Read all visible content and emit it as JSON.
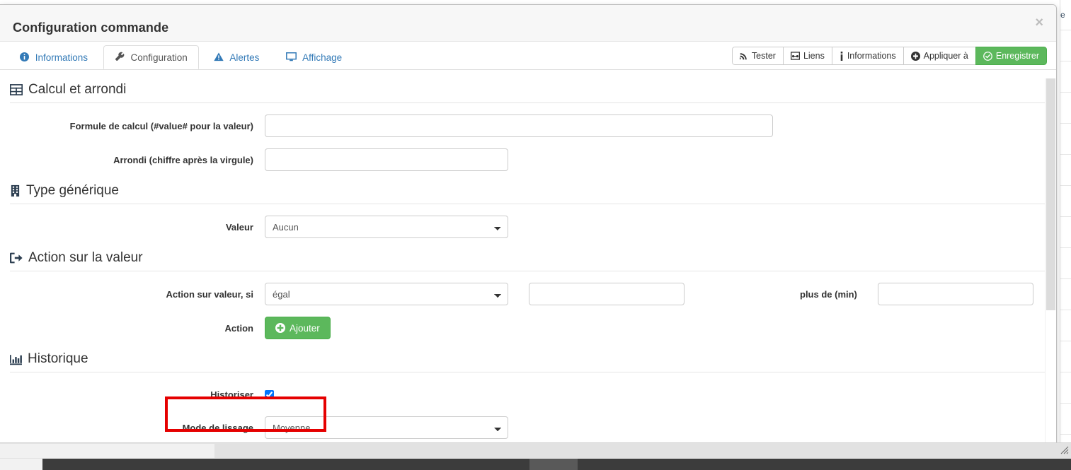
{
  "window": {
    "title": "Configuration commande",
    "close_label": "×"
  },
  "tabs": [
    {
      "label": "Informations",
      "icon": "info-circle-icon",
      "active": false
    },
    {
      "label": "Configuration",
      "icon": "wrench-icon",
      "active": true
    },
    {
      "label": "Alertes",
      "icon": "warning-triangle-icon",
      "active": false
    },
    {
      "label": "Affichage",
      "icon": "monitor-icon",
      "active": false
    }
  ],
  "toolbar": {
    "tester_label": "Tester",
    "liens_label": "Liens",
    "informations_label": "Informations",
    "appliquer_label": "Appliquer à",
    "enregistrer_label": "Enregistrer",
    "success_color": "#5cb85c"
  },
  "sections": {
    "calcul": {
      "title": "Calcul et arrondi",
      "icon": "table-icon",
      "formule_label": "Formule de calcul (#value# pour la valeur)",
      "formule_value": "",
      "arrondi_label": "Arrondi (chiffre après la virgule)",
      "arrondi_value": ""
    },
    "type_generique": {
      "title": "Type générique",
      "icon": "building-icon",
      "valeur_label": "Valeur",
      "valeur_selected": "Aucun"
    },
    "action_valeur": {
      "title": "Action sur la valeur",
      "icon": "sign-out-icon",
      "condition_label": "Action sur valeur, si",
      "condition_selected": "égal",
      "condition_value": "",
      "plus_de_label": "plus de (min)",
      "plus_de_value": "",
      "action_label": "Action",
      "ajouter_label": "Ajouter"
    },
    "historique": {
      "title": "Historique",
      "icon": "bar-chart-icon",
      "historiser_label": "Historiser",
      "historiser_checked": true,
      "lissage_label": "Mode de lissage",
      "lissage_selected": "Moyenne"
    }
  },
  "annotation": {
    "color": "#e50000",
    "target": "historiser-checkbox"
  },
  "background_page": {
    "partial_text": "e"
  }
}
